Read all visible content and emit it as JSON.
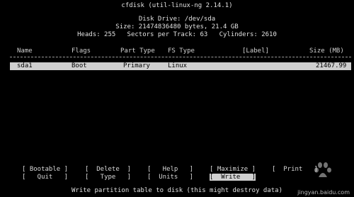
{
  "header": {
    "title": "cfdisk (util-linux-ng 2.14.1)",
    "disk_drive": "Disk Drive: /dev/sda",
    "size": "Size: 21474836480 bytes, 21.4 GB",
    "geometry": "Heads: 255   Sectors per Track: 63   Cylinders: 2610"
  },
  "table": {
    "columns": {
      "name": "Name",
      "flags": "Flags",
      "part_type": "Part Type",
      "fs_type": "FS Type",
      "label": "[Label]",
      "size": "Size (MB)"
    },
    "rows": [
      {
        "name": "sda1",
        "flags": "Boot",
        "part_type": "Primary",
        "fs_type": "Linux",
        "label": "",
        "size": "21467.99"
      }
    ]
  },
  "menu": {
    "bootable": "[ Bootable ]",
    "delete": "[  Delete  ]",
    "help": "[   Help   ]",
    "maximize": "[ Maximize ]",
    "print": "[  Print   ]",
    "quit": "[   Quit   ]",
    "type": "[   Type   ]",
    "units": "[  Units   ]",
    "write": "[  Write   ]",
    "selected": "write"
  },
  "status": {
    "text": "Write partition table to disk (this might destroy data)"
  },
  "watermark": {
    "logo_text": "Bai度经验",
    "site": "jingyan.baidu.com"
  },
  "colors": {
    "background": "#000000",
    "foreground": "#d8d8d8",
    "highlight_bg": "#cfcfcf",
    "highlight_fg": "#000000"
  }
}
